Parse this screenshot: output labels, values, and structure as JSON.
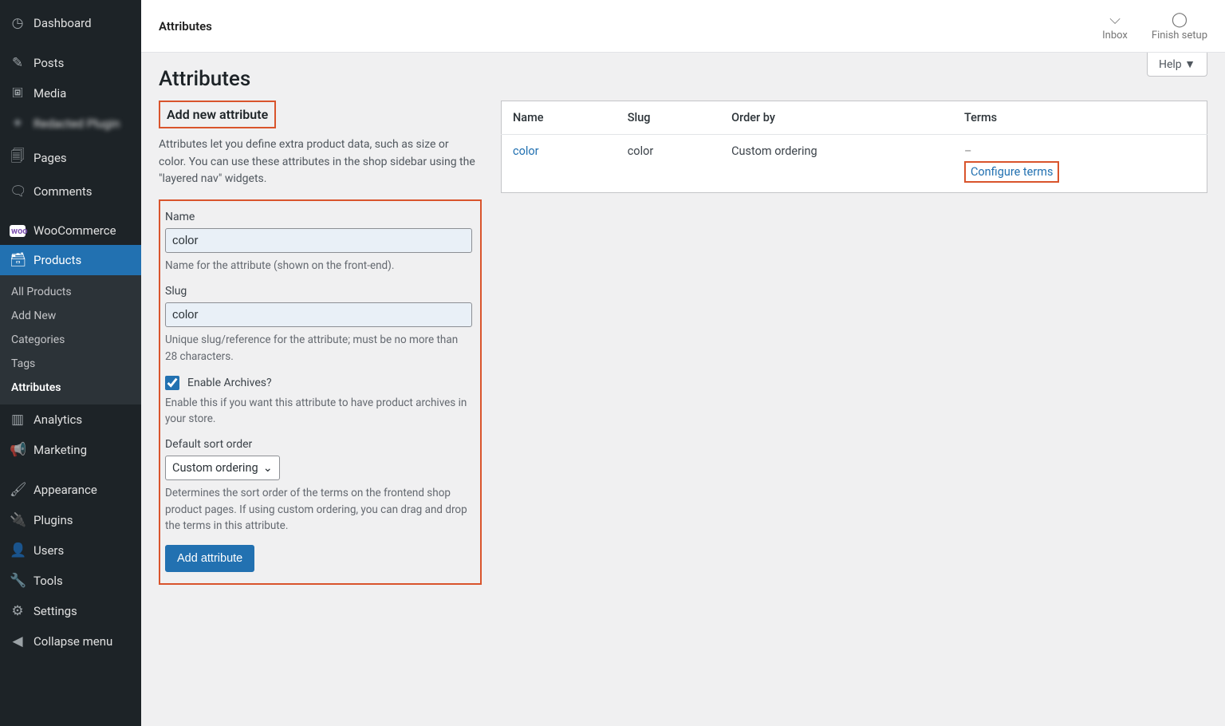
{
  "sidebar": {
    "items": [
      {
        "label": "Dashboard",
        "icon": "⌬"
      },
      {
        "label": "Posts",
        "icon": "📌"
      },
      {
        "label": "Media",
        "icon": "🖼"
      },
      {
        "label": "Redacted Plugin",
        "icon": "✦",
        "blurred": true
      },
      {
        "label": "Pages",
        "icon": "📄"
      },
      {
        "label": "Comments",
        "icon": "💬"
      },
      {
        "label": "WooCommerce",
        "icon": "W"
      },
      {
        "label": "Products",
        "icon": "🗂",
        "active": true
      },
      {
        "label": "Analytics",
        "icon": "📊"
      },
      {
        "label": "Marketing",
        "icon": "📣"
      },
      {
        "label": "Appearance",
        "icon": "🖌"
      },
      {
        "label": "Plugins",
        "icon": "🔌"
      },
      {
        "label": "Users",
        "icon": "👤"
      },
      {
        "label": "Tools",
        "icon": "🔧"
      },
      {
        "label": "Settings",
        "icon": "⚙"
      },
      {
        "label": "Collapse menu",
        "icon": "◀"
      }
    ],
    "sub_products": [
      "All Products",
      "Add New",
      "Categories",
      "Tags",
      "Attributes"
    ]
  },
  "topbar": {
    "breadcrumb": "Attributes",
    "inbox": "Inbox",
    "finish_setup": "Finish setup",
    "help": "Help"
  },
  "page": {
    "title": "Attributes"
  },
  "form": {
    "heading": "Add new attribute",
    "intro": "Attributes let you define extra product data, such as size or color. You can use these attributes in the shop sidebar using the \"layered nav\" widgets.",
    "name_label": "Name",
    "name_value": "color",
    "name_help": "Name for the attribute (shown on the front-end).",
    "slug_label": "Slug",
    "slug_value": "color",
    "slug_help": "Unique slug/reference for the attribute; must be no more than 28 characters.",
    "archives_label": "Enable Archives?",
    "archives_help": "Enable this if you want this attribute to have product archives in your store.",
    "sort_label": "Default sort order",
    "sort_value": "Custom ordering",
    "sort_help": "Determines the sort order of the terms on the frontend shop product pages. If using custom ordering, you can drag and drop the terms in this attribute.",
    "submit": "Add attribute"
  },
  "table": {
    "headers": {
      "name": "Name",
      "slug": "Slug",
      "order": "Order by",
      "terms": "Terms"
    },
    "rows": [
      {
        "name": "color",
        "slug": "color",
        "order": "Custom ordering",
        "terms_dash": "–",
        "configure": "Configure terms"
      }
    ]
  }
}
